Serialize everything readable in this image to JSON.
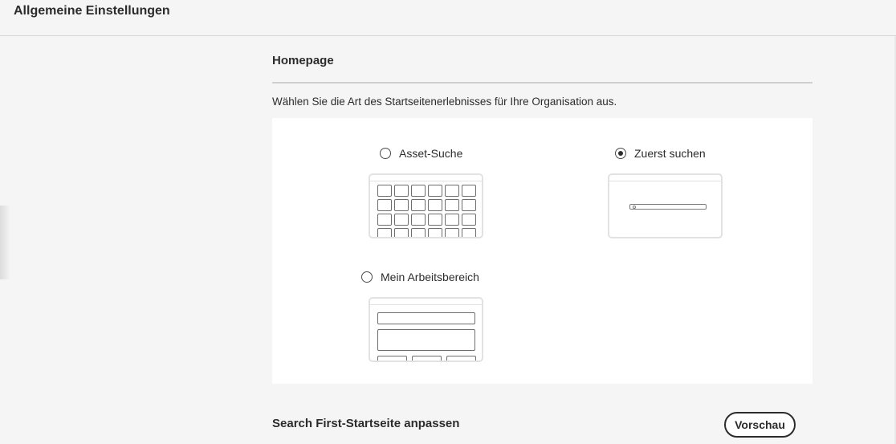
{
  "header": {
    "title": "Allgemeine Einstellungen"
  },
  "homepage": {
    "title": "Homepage",
    "description": "Wählen Sie die Art des Startseitenerlebnisses für Ihre Organisation aus.",
    "options": [
      {
        "label": "Asset-Suche",
        "selected": false,
        "icon": "asset-grid-preview"
      },
      {
        "label": "Zuerst suchen",
        "selected": true,
        "icon": "search-first-preview"
      },
      {
        "label": "Mein Arbeitsbereich",
        "selected": false,
        "icon": "workspace-preview"
      }
    ]
  },
  "customize": {
    "title": "Search First-Startseite anpassen",
    "preview_button": "Vorschau"
  }
}
